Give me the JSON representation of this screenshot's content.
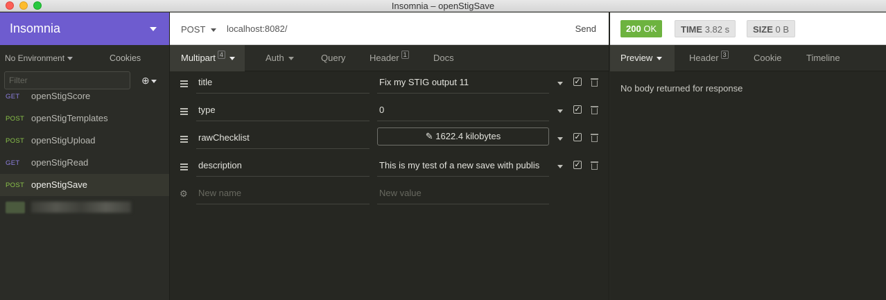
{
  "window": {
    "title": "Insomnia – openStigSave"
  },
  "sidebar": {
    "brand": "Insomnia",
    "environment": "No Environment",
    "cookies": "Cookies",
    "filter_placeholder": "Filter",
    "requests": [
      {
        "method": "GET",
        "name": "openStigScore"
      },
      {
        "method": "POST",
        "name": "openStigTemplates"
      },
      {
        "method": "POST",
        "name": "openStigUpload"
      },
      {
        "method": "GET",
        "name": "openStigRead"
      },
      {
        "method": "POST",
        "name": "openStigSave",
        "active": true
      }
    ]
  },
  "request": {
    "method": "POST",
    "url": "localhost:8082/",
    "send_label": "Send",
    "tabs": {
      "body": {
        "label": "Multipart",
        "count": "4"
      },
      "auth": "Auth",
      "query": "Query",
      "header": {
        "label": "Header",
        "count": "1"
      },
      "docs": "Docs"
    },
    "fields": [
      {
        "name": "title",
        "value": "Fix my STIG output 11"
      },
      {
        "name": "type",
        "value": "0"
      },
      {
        "name": "rawChecklist",
        "file_label": "1622.4 kilobytes"
      },
      {
        "name": "description",
        "value": "This is my test of a new save with publis"
      }
    ],
    "new_name_placeholder": "New name",
    "new_value_placeholder": "New value"
  },
  "response": {
    "status_code": "200",
    "status_text": "OK",
    "time_label": "TIME",
    "time_value": "3.82 s",
    "size_label": "SIZE",
    "size_value": "0 B",
    "tabs": {
      "preview": "Preview",
      "header": {
        "label": "Header",
        "count": "3"
      },
      "cookie": "Cookie",
      "timeline": "Timeline"
    },
    "body_text": "No body returned for response"
  },
  "colors": {
    "brand": "#6e5ccf",
    "status_ok": "#6db33f",
    "method_get": "#8d7fe0",
    "method_post": "#8bc34a"
  }
}
